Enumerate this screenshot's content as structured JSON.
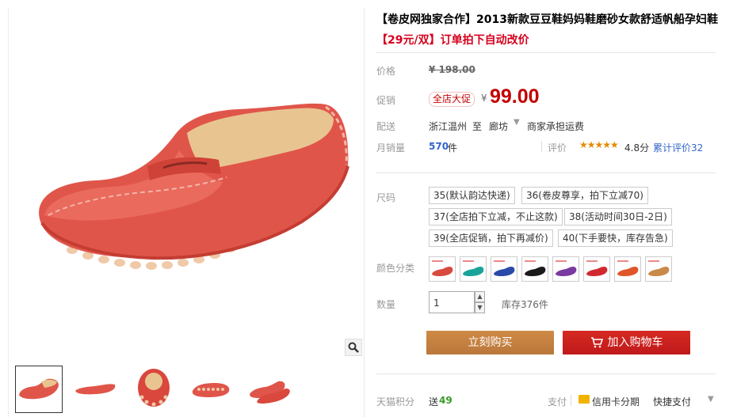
{
  "product": {
    "title": "【卷皮网独家合作】2013新款豆豆鞋妈妈鞋磨砂女款舒适帆船孕妇鞋",
    "subtitle": "【29元/双】订单拍下自动改价"
  },
  "gallery": {
    "main_image": "red-suede-moccasin-loafer",
    "zoom_icon": "magnifier-icon",
    "thumbnails": [
      "side-view",
      "side-view-flat",
      "sole-back",
      "sole-bottom",
      "pair-view"
    ]
  },
  "price": {
    "label": "价格",
    "original": "¥ 198.00"
  },
  "promo": {
    "label": "促销",
    "tag": "全店大促",
    "currency": "¥",
    "value": "99.00"
  },
  "shipping": {
    "label": "配送",
    "from": "浙江温州",
    "to_word": "至",
    "destination": "廊坊",
    "fee": "商家承担运费"
  },
  "sales": {
    "label": "月销量",
    "value": "570",
    "unit": "件",
    "rating_label": "评价",
    "stars": "★★★★★",
    "score": "4.8分",
    "reviews": "累计评价32"
  },
  "size": {
    "label": "尺码",
    "options": [
      "35(默认韵达快递)",
      "36(卷皮尊享，拍下立减70)",
      "37(全店拍下立减，不止这款)",
      "38(活动时间30日-2日)",
      "39(全店促销，拍下再减价)",
      "40(下手要快，库存告急)"
    ]
  },
  "color": {
    "label": "颜色分类",
    "swatches": [
      "#d84a3e",
      "#1aa39a",
      "#2a4aa8",
      "#1a1a1a",
      "#7a3aa0",
      "#d02a30",
      "#e0552a",
      "#c98a4a"
    ]
  },
  "quantity": {
    "label": "数量",
    "value": "1",
    "stock": "库存376件"
  },
  "actions": {
    "buy_now": "立刻购买",
    "add_cart": "加入购物车"
  },
  "footer": {
    "points_label": "天猫积分",
    "points_prefix": "送",
    "points_value": "49",
    "pay_label": "支付",
    "credit_installment": "信用卡分期",
    "quick_pay": "快捷支付"
  },
  "colors": {
    "accent_red": "#c40000",
    "buy_button": "#c17e3c",
    "cart_button": "#c8201d",
    "link_blue": "#3366cc",
    "points_green": "#3a9a2a"
  }
}
